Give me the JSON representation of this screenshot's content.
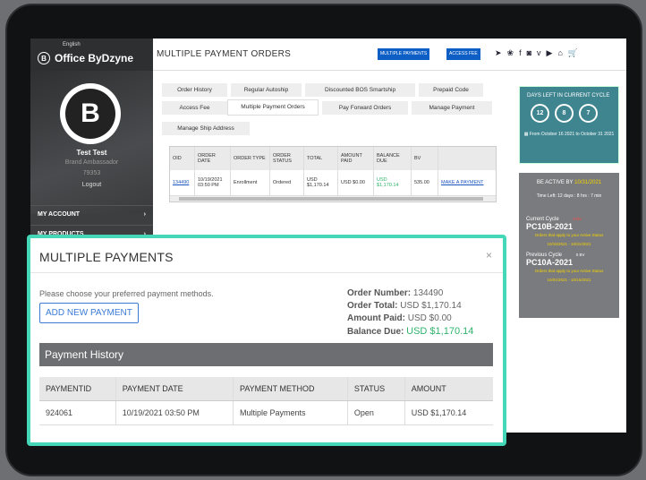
{
  "sidebar": {
    "language": "English",
    "brand": "Office ByDzyne",
    "logo_letter": "B",
    "user_name": "Test Test",
    "user_role": "Brand Ambassador",
    "user_id": "79353",
    "logout": "Logout",
    "menu": [
      {
        "label": "MY ACCOUNT"
      },
      {
        "label": "MY PRODUCTS"
      }
    ]
  },
  "header": {
    "title": "MULTIPLE PAYMENT ORDERS",
    "btn_multiple": "MULTIPLE PAYMENTS",
    "btn_access": "ACCESS FEE",
    "icons": [
      "telegram-icon",
      "community-icon",
      "facebook-icon",
      "instagram-icon",
      "vimeo-icon",
      "youtube-icon",
      "home-icon",
      "cart-icon"
    ]
  },
  "tabs": [
    {
      "label": "Order History"
    },
    {
      "label": "Regular Autoship"
    },
    {
      "label": "Discounted BOS Smartship"
    },
    {
      "label": "Prepaid Code"
    },
    {
      "label": "Access Fee"
    },
    {
      "label": "Multiple Payment Orders"
    },
    {
      "label": "Pay Forward Orders"
    },
    {
      "label": "Manage Payment"
    },
    {
      "label": "Manage Ship Address"
    }
  ],
  "orders": {
    "headers": [
      "OID",
      "ORDER DATE",
      "ORDER TYPE",
      "ORDER STATUS",
      "TOTAL",
      "AMOUNT PAID",
      "BALANCE DUE",
      "BV",
      ""
    ],
    "row": [
      "134490",
      "10/19/2021 03:50 PM",
      "Enrollment",
      "Ordered",
      "USD $1,170.14",
      "USD $0.00",
      "USD $1,170.14",
      "535.00",
      "MAKE A PAYMENT"
    ]
  },
  "cycle": {
    "title": "DAYS LEFT IN CURRENT CYCLE",
    "days": "12",
    "hours": "8",
    "mins": "7",
    "from": "From October 16 2021 to October 31 2021"
  },
  "active": {
    "title": "BE ACTIVE BY",
    "date": "10/31/2021",
    "time_left": "Time Left: 12 days : 8 hrs : 7 min",
    "current_label": "Current Cycle",
    "current_bv": "0 BV",
    "current_cycle": "PC10B-2021",
    "current_note": "Orders that apply to your Active Status",
    "current_range": "10/16/2021 - 10/31/2021",
    "prev_label": "Previous Cycle",
    "prev_bv": "0 BV",
    "prev_cycle": "PC10A-2021",
    "prev_note": "Orders that apply to your Active Status",
    "prev_range": "10/01/2021 - 10/15/2021"
  },
  "modal": {
    "title": "MULTIPLE PAYMENTS",
    "close": "×",
    "prompt": "Please choose your preferred payment methods.",
    "add_button": "ADD NEW PAYMENT",
    "order_number_label": "Order Number:",
    "order_number": "134490",
    "order_total_label": "Order Total:",
    "order_total": "USD $1,170.14",
    "amount_paid_label": "Amount Paid:",
    "amount_paid": "USD $0.00",
    "balance_due_label": "Balance Due:",
    "balance_due": "USD $1,170.14",
    "history_title": "Payment History",
    "history_headers": [
      "PAYMENTID",
      "PAYMENT DATE",
      "PAYMENT METHOD",
      "STATUS",
      "AMOUNT"
    ],
    "history_row": [
      "924061",
      "10/19/2021 03:50 PM",
      "Multiple Payments",
      "Open",
      "USD $1,170.14"
    ]
  }
}
